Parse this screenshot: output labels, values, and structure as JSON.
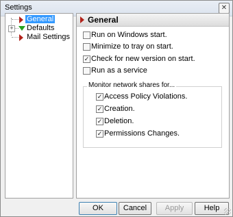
{
  "window": {
    "title": "Settings",
    "close_glyph": "✕"
  },
  "tree": {
    "items": [
      {
        "label": "General",
        "icon": "red-arrow-right-icon",
        "selected": true
      },
      {
        "label": "Defaults",
        "icon": "green-arrow-down-icon",
        "expander": "+"
      },
      {
        "label": "Mail Settings",
        "icon": "red-arrow-right-icon"
      }
    ]
  },
  "panel": {
    "header": "General",
    "options": [
      {
        "label": "Run on Windows start.",
        "checked": false
      },
      {
        "label": "Minimize to tray on start.",
        "checked": false
      },
      {
        "label": "Check for new version on start.",
        "checked": true
      },
      {
        "label": "Run as a service",
        "checked": false
      }
    ],
    "group": {
      "title": "Monitor network shares for...",
      "options": [
        {
          "label": "Access Policy Violations.",
          "checked": true
        },
        {
          "label": "Creation.",
          "checked": true
        },
        {
          "label": "Deletion.",
          "checked": true
        },
        {
          "label": "Permissions Changes.",
          "checked": true
        }
      ]
    },
    "check_glyph": "✓"
  },
  "buttons": {
    "ok": "OK",
    "cancel": "Cancel",
    "apply": "Apply",
    "help": "Help"
  },
  "colors": {
    "accent_red": "#b2231b",
    "accent_green": "#26a31e",
    "selection": "#3399ff"
  }
}
